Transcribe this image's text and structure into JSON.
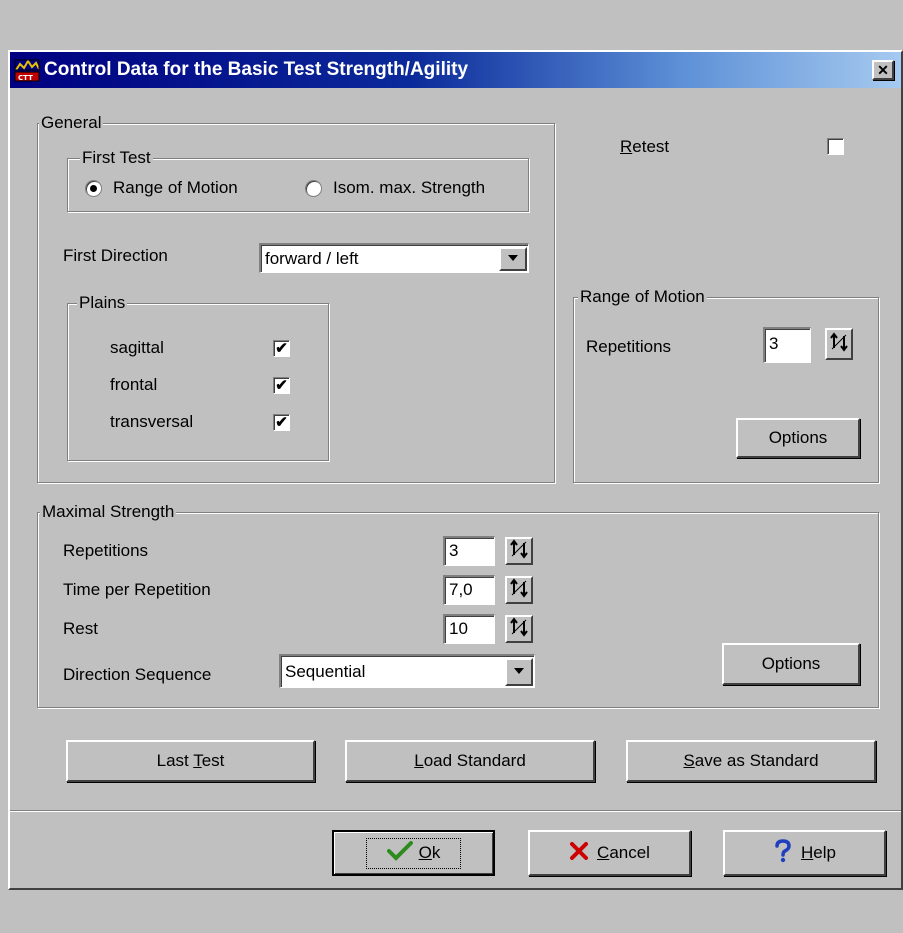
{
  "window": {
    "title": "Control Data for the Basic Test Strength/Agility",
    "close_glyph": "✕"
  },
  "general": {
    "legend": "General",
    "first_test": {
      "legend": "First Test",
      "options": [
        {
          "label": "Range of Motion",
          "selected": true
        },
        {
          "label": "Isom. max. Strength",
          "selected": false
        }
      ]
    },
    "first_direction": {
      "label": "First Direction",
      "value": "forward / left"
    },
    "plains": {
      "legend": "Plains",
      "items": [
        {
          "label": "sagittal",
          "checked": true
        },
        {
          "label": "frontal",
          "checked": true
        },
        {
          "label": "transversal",
          "checked": true
        }
      ]
    }
  },
  "retest": {
    "label_underlined": "R",
    "label_rest": "etest",
    "checked": false
  },
  "range_of_motion": {
    "legend": "Range of Motion",
    "repetitions_label": "Repetitions",
    "repetitions_value": "3",
    "options_label": "Options"
  },
  "maximal_strength": {
    "legend": "Maximal Strength",
    "repetitions_label": "Repetitions",
    "repetitions_value": "3",
    "time_label": "Time per Repetition",
    "time_value": "7,0",
    "rest_label": "Rest",
    "rest_value": "10",
    "sequence_label": "Direction Sequence",
    "sequence_value": "Sequential",
    "options_label": "Options"
  },
  "actions": {
    "last_test_pre": "Last ",
    "last_test_u": "T",
    "last_test_post": "est",
    "load_u": "L",
    "load_post": "oad Standard",
    "save_u": "S",
    "save_post": "ave as Standard"
  },
  "footer": {
    "ok_u": "O",
    "ok_post": "k",
    "cancel_u": "C",
    "cancel_post": "ancel",
    "help_u": "H",
    "help_post": "elp"
  },
  "colors": {
    "title_start": "#000080",
    "title_end": "#a6caf0",
    "ok_check": "#2e8b1e",
    "cancel_x": "#cc0000",
    "help_q": "#1f3fbf"
  }
}
